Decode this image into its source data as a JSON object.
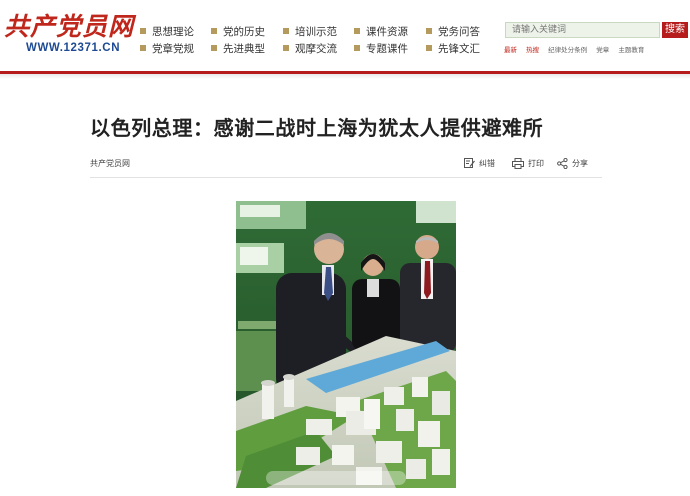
{
  "header": {
    "logo_text": "共产党员网",
    "logo_url": "WWW.12371.CN",
    "nav": [
      {
        "label": "思想理论"
      },
      {
        "label": "党的历史"
      },
      {
        "label": "培训示范"
      },
      {
        "label": "课件资源"
      },
      {
        "label": "党务问答"
      },
      {
        "label": "党章党规"
      },
      {
        "label": "先进典型"
      },
      {
        "label": "观摩交流"
      },
      {
        "label": "专题课件"
      },
      {
        "label": "先锋文汇"
      }
    ],
    "search": {
      "placeholder": "请输入关键词",
      "button_label": "搜索",
      "links": [
        "最新",
        "热搜",
        "纪律处分条例",
        "党章",
        "主题教育"
      ]
    },
    "accent_color": "#b71c1c"
  },
  "article": {
    "title": "以色列总理：感谢二战时上海为犹太人提供避难所",
    "source": "共产党员网",
    "actions": {
      "correct": "纠错",
      "print": "打印",
      "share": "分享"
    }
  }
}
